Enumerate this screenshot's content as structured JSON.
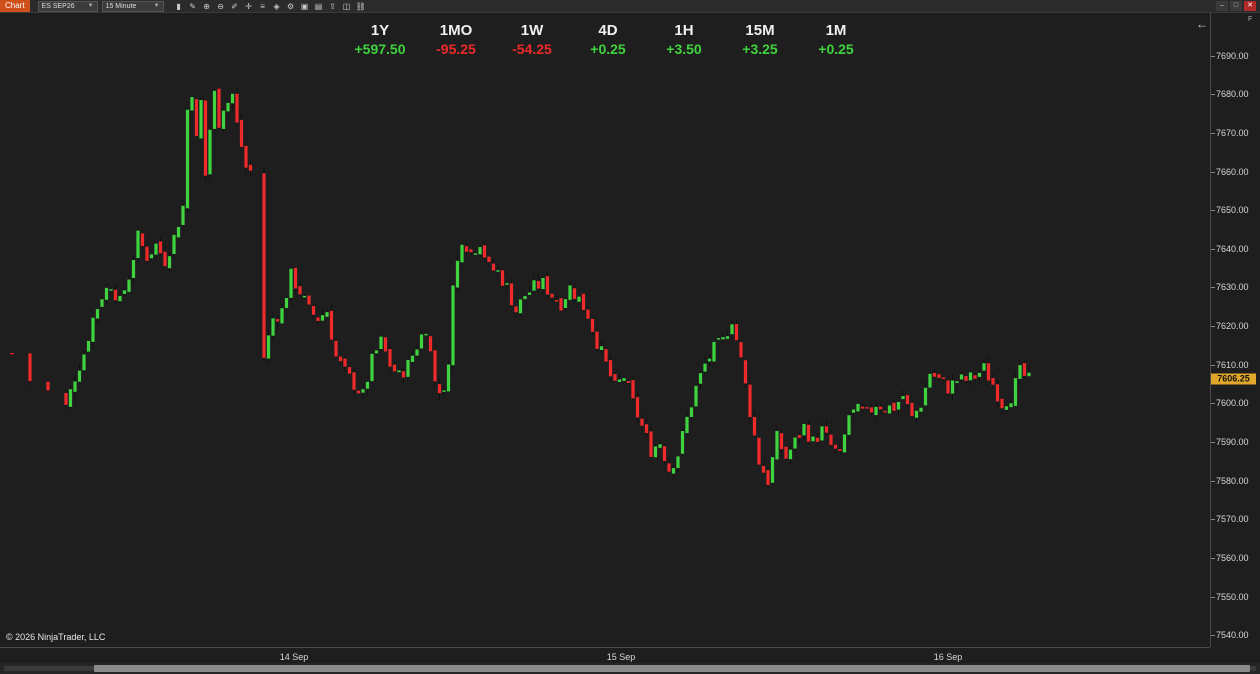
{
  "toolbar": {
    "chart_tab": "Chart",
    "instrument": "ES SEP26",
    "interval": "15 Minute",
    "tools": [
      "cursor-icon",
      "crosshair-icon",
      "zoom-in-icon",
      "zoom-out-icon",
      "draw-icon",
      "drawing-tool-icon",
      "properties-icon",
      "strategies-icon",
      "indicators-icon",
      "data-box-icon",
      "templates-icon",
      "share-icon",
      "split-icon",
      "window-link-icon"
    ],
    "window_buttons": [
      "minimize",
      "maximize",
      "close"
    ]
  },
  "performance": [
    {
      "label": "1Y",
      "value": "+597.50",
      "dir": "up"
    },
    {
      "label": "1MO",
      "value": "-95.25",
      "dir": "down"
    },
    {
      "label": "1W",
      "value": "-54.25",
      "dir": "down"
    },
    {
      "label": "4D",
      "value": "+0.25",
      "dir": "up"
    },
    {
      "label": "1H",
      "value": "+3.50",
      "dir": "up"
    },
    {
      "label": "15M",
      "value": "+3.25",
      "dir": "up"
    },
    {
      "label": "1M",
      "value": "+0.25",
      "dir": "up"
    }
  ],
  "colors": {
    "up": "#3fd43f",
    "down": "#ee2a2a",
    "background": "#1e1e1e",
    "last_price_marker": "#e0a72a"
  },
  "copyright": "© 2026 NinjaTrader, LLC",
  "f_label": "F",
  "last_price": "7606.25",
  "chart_data": {
    "type": "candlestick",
    "instrument": "ES SEP26",
    "interval": "15 Minute",
    "y_ticks": [
      "7690.00",
      "7680.00",
      "7670.00",
      "7660.00",
      "7650.00",
      "7640.00",
      "7630.00",
      "7620.00",
      "7610.00",
      "7600.00",
      "7590.00",
      "7580.00",
      "7570.00",
      "7560.00",
      "7550.00",
      "7540.00"
    ],
    "x_ticks": [
      "14 Sep",
      "15 Sep",
      "16 Sep"
    ],
    "ylim": [
      7537,
      7701
    ],
    "close_path": [
      [
        0,
        7613
      ],
      [
        4,
        7606
      ],
      [
        8,
        7603
      ],
      [
        12,
        7599
      ],
      [
        14,
        7607
      ],
      [
        16,
        7613
      ],
      [
        18,
        7622
      ],
      [
        20,
        7628
      ],
      [
        22,
        7631
      ],
      [
        24,
        7626
      ],
      [
        26,
        7633
      ],
      [
        28,
        7643
      ],
      [
        30,
        7638
      ],
      [
        32,
        7641
      ],
      [
        34,
        7637
      ],
      [
        36,
        7643
      ],
      [
        38,
        7651
      ],
      [
        39,
        7676
      ],
      [
        40,
        7681
      ],
      [
        41,
        7668
      ],
      [
        42,
        7678
      ],
      [
        43,
        7659
      ],
      [
        44,
        7671
      ],
      [
        45,
        7680
      ],
      [
        46,
        7673
      ],
      [
        47,
        7677
      ],
      [
        48,
        7678
      ],
      [
        49,
        7680
      ],
      [
        50,
        7672
      ],
      [
        52,
        7661
      ],
      [
        53,
        7660
      ],
      [
        56,
        7612
      ],
      [
        58,
        7622
      ],
      [
        60,
        7624
      ],
      [
        62,
        7633
      ],
      [
        64,
        7629
      ],
      [
        66,
        7624
      ],
      [
        68,
        7622
      ],
      [
        70,
        7624
      ],
      [
        72,
        7612
      ],
      [
        74,
        7608
      ],
      [
        76,
        7605
      ],
      [
        78,
        7602
      ],
      [
        80,
        7611
      ],
      [
        82,
        7616
      ],
      [
        84,
        7610
      ],
      [
        86,
        7607
      ],
      [
        88,
        7610
      ],
      [
        90,
        7615
      ],
      [
        92,
        7620
      ],
      [
        94,
        7606
      ],
      [
        96,
        7602
      ],
      [
        97,
        7612
      ],
      [
        98,
        7630
      ],
      [
        100,
        7643
      ],
      [
        102,
        7639
      ],
      [
        104,
        7642
      ],
      [
        106,
        7635
      ],
      [
        108,
        7634
      ],
      [
        110,
        7630
      ],
      [
        112,
        7624
      ],
      [
        114,
        7628
      ],
      [
        116,
        7630
      ],
      [
        118,
        7631
      ],
      [
        120,
        7628
      ],
      [
        122,
        7626
      ],
      [
        124,
        7630
      ],
      [
        126,
        7627
      ],
      [
        128,
        7623
      ],
      [
        130,
        7616
      ],
      [
        132,
        7610
      ],
      [
        134,
        7604
      ],
      [
        136,
        7607
      ],
      [
        138,
        7600
      ],
      [
        140,
        7594
      ],
      [
        142,
        7588
      ],
      [
        144,
        7590
      ],
      [
        146,
        7583
      ],
      [
        148,
        7587
      ],
      [
        150,
        7596
      ],
      [
        152,
        7604
      ],
      [
        154,
        7610
      ],
      [
        156,
        7614
      ],
      [
        158,
        7616
      ],
      [
        160,
        7622
      ],
      [
        162,
        7611
      ],
      [
        164,
        7598
      ],
      [
        166,
        7585
      ],
      [
        168,
        7580
      ],
      [
        170,
        7591
      ],
      [
        172,
        7586
      ],
      [
        174,
        7590
      ],
      [
        176,
        7594
      ],
      [
        178,
        7590
      ],
      [
        180,
        7593
      ],
      [
        182,
        7589
      ],
      [
        184,
        7586
      ],
      [
        186,
        7597
      ],
      [
        188,
        7598
      ],
      [
        190,
        7597
      ],
      [
        192,
        7600
      ],
      [
        194,
        7599
      ],
      [
        196,
        7599
      ],
      [
        198,
        7602
      ],
      [
        200,
        7596
      ],
      [
        202,
        7600
      ],
      [
        204,
        7608
      ],
      [
        206,
        7606
      ],
      [
        208,
        7604
      ],
      [
        210,
        7606
      ],
      [
        212,
        7606
      ],
      [
        214,
        7607
      ],
      [
        216,
        7609
      ],
      [
        218,
        7605
      ],
      [
        220,
        7600
      ],
      [
        222,
        7602
      ],
      [
        224,
        7608
      ],
      [
        226,
        7606
      ]
    ],
    "last_price": 7606.25
  }
}
